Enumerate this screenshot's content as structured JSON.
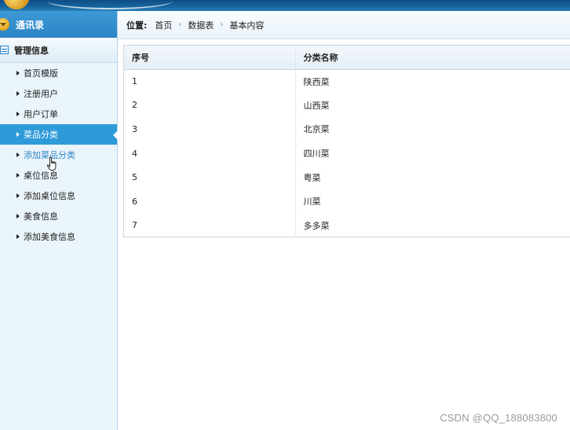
{
  "sidebar": {
    "header_label": "通讯录",
    "section_label": "管理信息",
    "items": [
      {
        "label": "首页模版"
      },
      {
        "label": "注册用户"
      },
      {
        "label": "用户订单"
      },
      {
        "label": "菜品分类"
      },
      {
        "label": "添加菜品分类"
      },
      {
        "label": "桌位信息"
      },
      {
        "label": "添加桌位信息"
      },
      {
        "label": "美食信息"
      },
      {
        "label": "添加美食信息"
      }
    ],
    "active_item": "菜品分类",
    "hover_item": "添加菜品分类"
  },
  "breadcrumb": {
    "label": "位置:",
    "items": [
      "首页",
      "数据表",
      "基本内容"
    ]
  },
  "table": {
    "columns": [
      "序号",
      "分类名称"
    ],
    "rows": [
      [
        "1",
        "陕西菜"
      ],
      [
        "2",
        "山西菜"
      ],
      [
        "3",
        "北京菜"
      ],
      [
        "4",
        "四川菜"
      ],
      [
        "5",
        "粤菜"
      ],
      [
        "6",
        "川菜"
      ],
      [
        "7",
        "多多菜"
      ]
    ]
  },
  "watermark": "CSDN @QQ_188083800",
  "colors": {
    "accent": "#2e9ad8",
    "sidebar_bg": "#eaf4fb",
    "header_bg": "#2b84c4"
  }
}
